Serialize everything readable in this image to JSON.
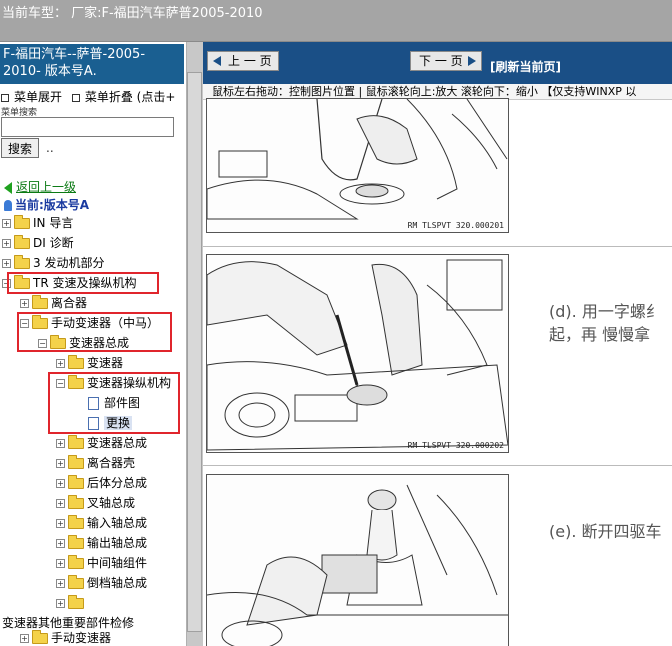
{
  "topbar": {
    "title": "当前车型：  厂家:F-福田汽车萨普2005-2010"
  },
  "left": {
    "model_line1": "F-福田汽车--萨普-2005-",
    "model_line2": "2010- 版本号A.",
    "menu_expand": "菜单展开",
    "menu_collapse": "菜单折叠 (点击+",
    "search_label": "菜单搜索",
    "search_value": "",
    "search_button": "搜索",
    "dots": "..",
    "back_link": "返回上一级",
    "current": "当前:版本号A",
    "tree": [
      {
        "label": "IN 导言"
      },
      {
        "label": "DI 诊断"
      },
      {
        "label": "3 发动机部分"
      },
      {
        "label": "TR 变速及操纵机构"
      },
      {
        "label": "离合器"
      },
      {
        "label": "手动变速器（中马）"
      },
      {
        "label": "变速器总成"
      },
      {
        "label": "变速器"
      },
      {
        "label": "变速器操纵机构"
      },
      {
        "label": "部件图"
      },
      {
        "label": "更换"
      },
      {
        "label": "变速器总成"
      },
      {
        "label": "离合器壳"
      },
      {
        "label": "后体分总成"
      },
      {
        "label": "叉轴总成"
      },
      {
        "label": "输入轴总成"
      },
      {
        "label": "输出轴总成"
      },
      {
        "label": "中间轴组件"
      },
      {
        "label": "倒档轴总成"
      },
      {
        "label": ""
      }
    ],
    "footer_text": "变速器其他重要部件检修",
    "footer_item": "手动变速器"
  },
  "right": {
    "prev_button": "上 一 页",
    "next_button": "下 一 页",
    "refresh": "[刷新当前页]",
    "hint": "鼠标左右拖动：控制图片位置 | 鼠标滚轮向上:放大  滚轮向下：缩小 【仅支持WINXP 以",
    "fig1_code": "RM TLSPVT 320.000201",
    "fig2_code": "RM TLSPVT 320.000202",
    "step_d_line1": "(d). 用一字螺纟",
    "step_d_line2": "起，再 慢慢拿",
    "step_e": "(e). 断开四驱车"
  }
}
